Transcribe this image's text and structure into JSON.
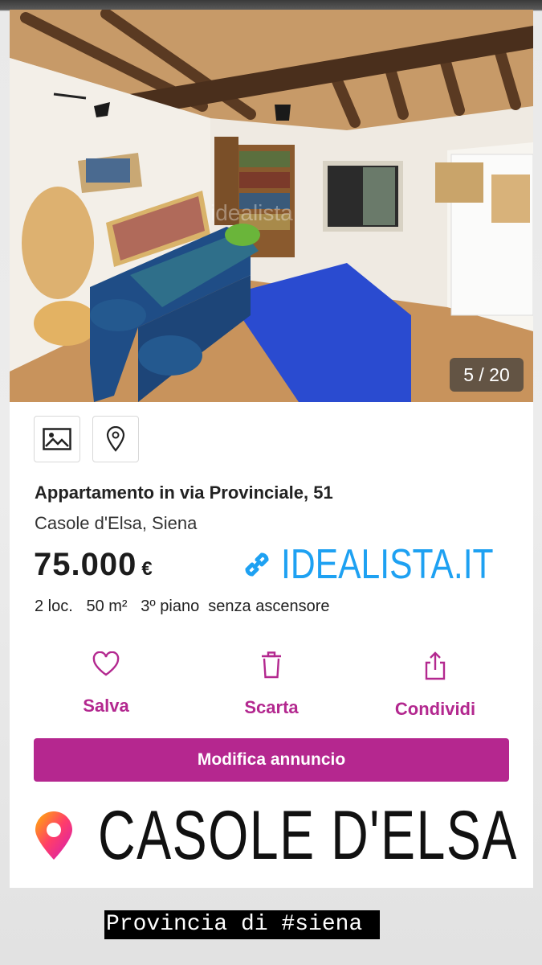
{
  "photo": {
    "counter": "5 / 20",
    "watermark": "idealista"
  },
  "icons": {
    "gallery": "image-icon",
    "map": "map-pin-icon"
  },
  "listing": {
    "title": "Appartamento in via Provinciale, 51",
    "location": "Casole d'Elsa, Siena",
    "price": "75.000",
    "currency": "€",
    "features": "2 loc.   50 m²   3º piano  senza ascensore"
  },
  "brand": {
    "label": "IDEALISTA.IT",
    "icon": "link-icon",
    "color": "#1ea1f2"
  },
  "actions": [
    {
      "label": "Salva",
      "icon": "heart-icon"
    },
    {
      "label": "Scarta",
      "icon": "trash-icon"
    },
    {
      "label": "Condividi",
      "icon": "share-icon"
    }
  ],
  "edit_button": {
    "label": "Modifica annuncio",
    "color": "#b5278f"
  },
  "sticker": {
    "label": "CASOLE D'ELSA",
    "icon": "location-pin-icon"
  },
  "caption": "Provincia di #siena"
}
